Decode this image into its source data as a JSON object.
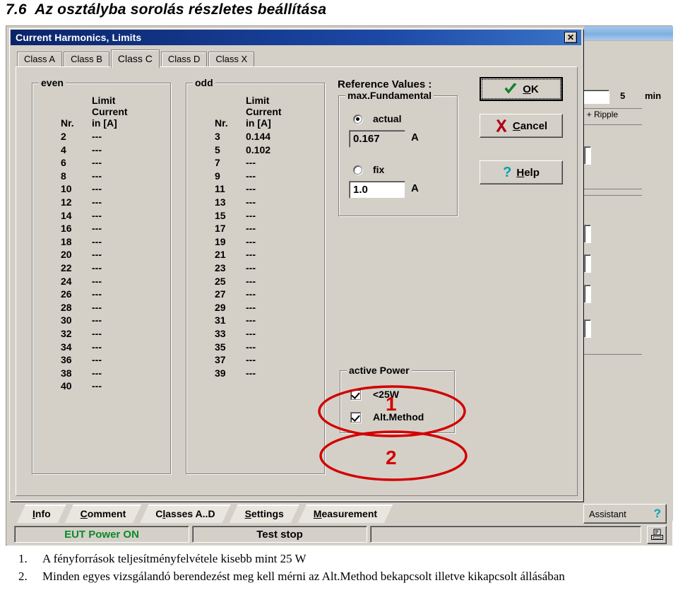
{
  "heading": "7.6  Az osztályba sorolás részletes beállítása",
  "dialog": {
    "title": "Current Harmonics, Limits",
    "close_label": "✕",
    "tabs": [
      {
        "label": "Class A",
        "active": false
      },
      {
        "label": "Class B",
        "active": false
      },
      {
        "label": "Class C",
        "active": true
      },
      {
        "label": "Class D",
        "active": false
      },
      {
        "label": "Class X",
        "active": false
      }
    ],
    "even_group": {
      "legend": "even",
      "headers": [
        "Nr.",
        "Limit\nCurrent\nin [A]"
      ],
      "rows": [
        {
          "nr": "2",
          "limit": "---"
        },
        {
          "nr": "4",
          "limit": "---"
        },
        {
          "nr": "6",
          "limit": "---"
        },
        {
          "nr": "8",
          "limit": "---"
        },
        {
          "nr": "10",
          "limit": "---"
        },
        {
          "nr": "12",
          "limit": "---"
        },
        {
          "nr": "14",
          "limit": "---"
        },
        {
          "nr": "16",
          "limit": "---"
        },
        {
          "nr": "18",
          "limit": "---"
        },
        {
          "nr": "20",
          "limit": "---"
        },
        {
          "nr": "22",
          "limit": "---"
        },
        {
          "nr": "24",
          "limit": "---"
        },
        {
          "nr": "26",
          "limit": "---"
        },
        {
          "nr": "28",
          "limit": "---"
        },
        {
          "nr": "30",
          "limit": "---"
        },
        {
          "nr": "32",
          "limit": "---"
        },
        {
          "nr": "34",
          "limit": "---"
        },
        {
          "nr": "36",
          "limit": "---"
        },
        {
          "nr": "38",
          "limit": "---"
        },
        {
          "nr": "40",
          "limit": "---"
        }
      ]
    },
    "odd_group": {
      "legend": "odd",
      "headers": [
        "Nr.",
        "Limit\nCurrent\nin [A]"
      ],
      "rows": [
        {
          "nr": "3",
          "limit": "0.144"
        },
        {
          "nr": "5",
          "limit": "0.102"
        },
        {
          "nr": "7",
          "limit": "---"
        },
        {
          "nr": "9",
          "limit": "---"
        },
        {
          "nr": "11",
          "limit": "---"
        },
        {
          "nr": "13",
          "limit": "---"
        },
        {
          "nr": "15",
          "limit": "---"
        },
        {
          "nr": "17",
          "limit": "---"
        },
        {
          "nr": "19",
          "limit": "---"
        },
        {
          "nr": "21",
          "limit": "---"
        },
        {
          "nr": "23",
          "limit": "---"
        },
        {
          "nr": "25",
          "limit": "---"
        },
        {
          "nr": "27",
          "limit": "---"
        },
        {
          "nr": "29",
          "limit": "---"
        },
        {
          "nr": "31",
          "limit": "---"
        },
        {
          "nr": "33",
          "limit": "---"
        },
        {
          "nr": "35",
          "limit": "---"
        },
        {
          "nr": "37",
          "limit": "---"
        },
        {
          "nr": "39",
          "limit": "---"
        }
      ]
    },
    "reference": {
      "title": "Reference Values :",
      "group_legend": "max.Fundamental",
      "actual_label": "actual",
      "actual_selected": true,
      "actual_value": "0.167",
      "actual_unit": "A",
      "fix_label": "fix",
      "fix_selected": false,
      "fix_value": "1.0",
      "fix_unit": "A"
    },
    "active_power": {
      "legend": "active Power",
      "items": [
        {
          "label": "<25W",
          "checked": true
        },
        {
          "label": "Alt.Method",
          "checked": true
        }
      ]
    },
    "buttons": [
      {
        "name": "ok",
        "label": "OK",
        "accel": "O",
        "icon": "check-icon",
        "default": true
      },
      {
        "name": "cancel",
        "label": "Cancel",
        "accel": "C",
        "icon": "cross-icon",
        "default": false
      },
      {
        "name": "help",
        "label": "Help",
        "accel": "H",
        "icon": "question-icon",
        "default": false
      }
    ]
  },
  "background_window": {
    "minimize_label": "_",
    "maximize_label": "□",
    "close_label": "✕",
    "duration_value": "5",
    "duration_unit": "min",
    "combo_label": "DC + Ripple"
  },
  "bottom_tabs": [
    {
      "label": "Info",
      "accel": "I"
    },
    {
      "label": "Comment",
      "accel": "C"
    },
    {
      "label": "Classes A..D",
      "accel": "l"
    },
    {
      "label": "Settings",
      "accel": "S"
    },
    {
      "label": "Measurement",
      "accel": "M"
    }
  ],
  "assistant": {
    "label": "Assistant",
    "icon": "question-icon"
  },
  "status": {
    "power": "EUT Power ON",
    "test": "Test stop",
    "message": "",
    "print_icon": "printer-icon"
  },
  "annotations": [
    {
      "number": "1",
      "target": "active-power-25w"
    },
    {
      "number": "2",
      "target": "active-power-alt-method"
    }
  ],
  "caption": {
    "items": [
      {
        "marker": "1.",
        "text": "A fényforrások teljesítményfelvétele kisebb mint 25 W"
      },
      {
        "marker": "2.",
        "text": "Minden egyes vizsgálandó berendezést meg kell mérni az Alt.Method bekapcsolt illetve kikapcsolt állásában"
      }
    ]
  },
  "colors": {
    "annotation": "#d20000",
    "titlebar": "#0a246a",
    "face": "#d4d0c8",
    "power_on": "#0a8a2a"
  }
}
